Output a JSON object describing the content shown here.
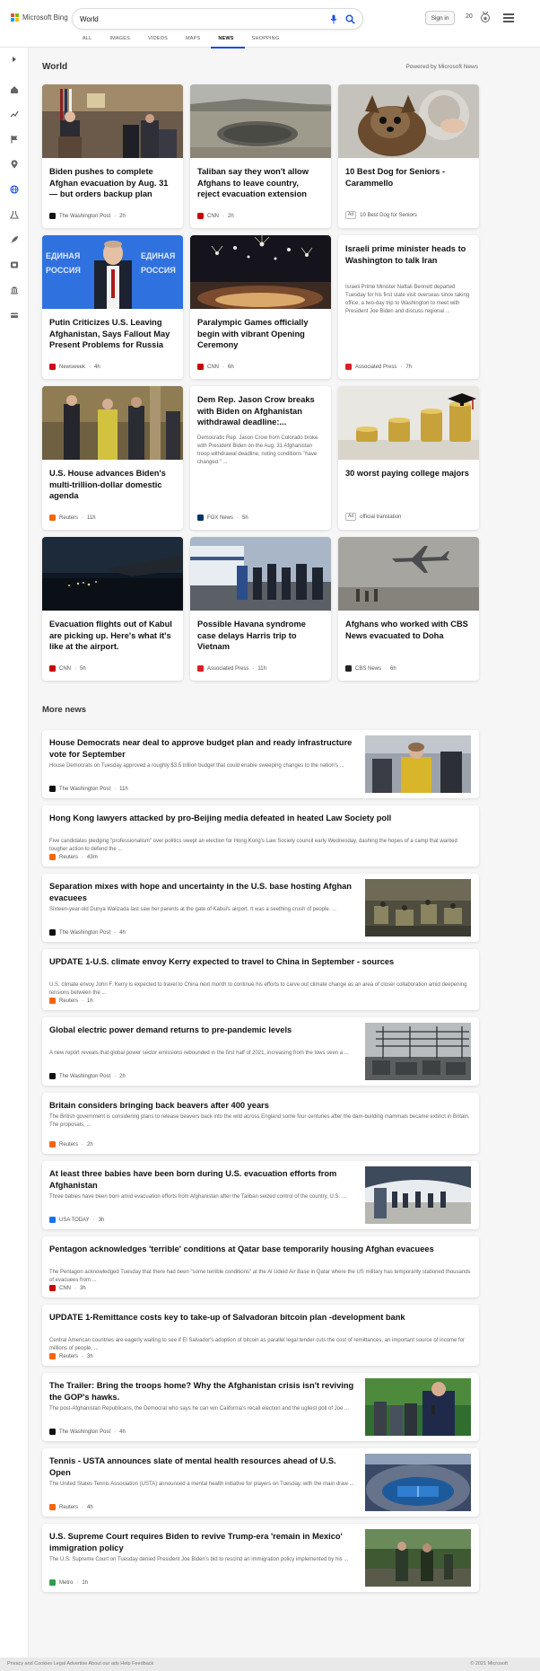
{
  "header": {
    "brand": "Microsoft Bing",
    "search_value": "World",
    "signin": "Sign in",
    "points": "20",
    "tabs": [
      "ALL",
      "IMAGES",
      "VIDEOS",
      "MAPS",
      "NEWS",
      "SHOPPING"
    ],
    "active_tab": "NEWS"
  },
  "section": {
    "title": "World",
    "powered_by": "Powered by Microsoft News"
  },
  "cards": [
    {
      "title": "Biden pushes to complete Afghan evacuation by Aug. 31 — but orders backup plan",
      "source": "The Washington Post",
      "age": "2h",
      "ad": false,
      "favicon_color": "#111111",
      "image": "press-briefing"
    },
    {
      "title": "Taliban say they won't allow Afghans to leave country, reject evacuation extension",
      "source": "CNN",
      "age": "2h",
      "ad": false,
      "favicon_color": "#cc0000",
      "image": "airport-crowd"
    },
    {
      "title": "10 Best Dog for Seniors - Carammello",
      "source": "10 Best Dog for Seniors",
      "age": "",
      "ad": true,
      "ad_label": "Ad",
      "favicon_color": "",
      "image": "dog-senior"
    },
    {
      "title": "Putin Criticizes U.S. Leaving Afghanistan, Says Fallout May Present Problems for Russia",
      "source": "Newsweek",
      "age": "4h",
      "ad": false,
      "favicon_color": "#d0021b",
      "image": "putin-stage",
      "image_text": [
        "ЕДИНАЯ",
        "РОССИЯ",
        "ЕДИНАЯ",
        "РОССИЯ"
      ]
    },
    {
      "title": "Paralympic Games officially begin with vibrant Opening Ceremony",
      "source": "CNN",
      "age": "6h",
      "ad": false,
      "favicon_color": "#cc0000",
      "image": "fireworks-stadium"
    },
    {
      "title": "Israeli prime minister heads to Washington to talk Iran",
      "snippet": "Israeli Prime Minister Naftali Bennett departed Tuesday for his first state visit overseas since taking office, a two-day trip to Washington to meet with President Joe Biden and discuss regional ...",
      "source": "Associated Press",
      "age": "7h",
      "ad": false,
      "favicon_color": "#e31b23",
      "image": ""
    },
    {
      "title": "U.S. House advances Biden's multi-trillion-dollar domestic agenda",
      "source": "Reuters",
      "age": "11h",
      "ad": false,
      "favicon_color": "#fa6400",
      "image": "capitol-walk"
    },
    {
      "title": "Dem Rep. Jason Crow breaks with Biden on Afghanistan withdrawal deadline:...",
      "snippet": "Democratic Rep. Jason Crow from Colorado broke with President Biden on the Aug. 31 Afghanistan troop withdrawal deadline, noting conditions \"have changed.\" ...",
      "source": "FOX News",
      "age": "5h",
      "ad": false,
      "favicon_color": "#003366",
      "image": ""
    },
    {
      "title": "30 worst paying college majors",
      "source": "official translation",
      "age": "",
      "ad": true,
      "ad_label": "Ad",
      "favicon_color": "",
      "image": "coins-cap"
    },
    {
      "title": "Evacuation flights out of Kabul are picking up. Here's what it's like at the airport.",
      "source": "CNN",
      "age": "5h",
      "ad": false,
      "favicon_color": "#cc0000",
      "image": "night-airport"
    },
    {
      "title": "Possible Havana syndrome case delays Harris trip to Vietnam",
      "source": "Associated Press",
      "age": "11h",
      "ad": false,
      "favicon_color": "#e31b23",
      "image": "tarmac-group"
    },
    {
      "title": "Afghans who worked with CBS News evacuated to Doha",
      "source": "CBS News",
      "age": "6h",
      "ad": false,
      "favicon_color": "#222222",
      "image": "plane-haze"
    }
  ],
  "more_news": {
    "title": "More news",
    "items": [
      {
        "title": "House Democrats near deal to approve budget plan and ready infrastructure vote for September",
        "snippet": "House Democrats on Tuesday approved a roughly $3.5 trillion budget that could enable sweeping changes to the nation's ...",
        "source": "The Washington Post",
        "age": "11h",
        "favicon_color": "#111111",
        "image": "pelosi-yellow"
      },
      {
        "title": "Hong Kong lawyers attacked by pro-Beijing media defeated in heated Law Society poll",
        "snippet": "Five candidates pledging \"professionalism\" over politics swept an election for Hong Kong's Law Society council early Wednesday, dashing the hopes of a camp that wanted tougher action to defend the ...",
        "source": "Reuters",
        "age": "43m",
        "favicon_color": "#fa6400",
        "image": ""
      },
      {
        "title": "Separation mixes with hope and uncertainty in the U.S. base hosting Afghan evacuees",
        "snippet": "Sixteen-year-old Dunya Walizada last saw her parents at the gate of Kabul's airport. It was a seething crush of people. ...",
        "source": "The Washington Post",
        "age": "4h",
        "favicon_color": "#111111",
        "image": "evacuees-hangar"
      },
      {
        "title": "UPDATE 1-U.S. climate envoy Kerry expected to travel to China in September - sources",
        "snippet": "U.S. climate envoy John F. Kerry is expected to travel to China next month to continue his efforts to carve out climate change as an area of closer collaboration amid deepening tensions between the ...",
        "source": "Reuters",
        "age": "1h",
        "favicon_color": "#fa6400",
        "image": ""
      },
      {
        "title": "Global electric power demand returns to pre-pandemic levels",
        "snippet": "A new report reveals that global power sector emissions rebounded in the first half of 2021, increasing from the lows seen a ...",
        "source": "The Washington Post",
        "age": "2h",
        "favicon_color": "#111111",
        "image": "power-lines"
      },
      {
        "title": "Britain considers bringing back beavers after 400 years",
        "snippet": "The British government is considering plans to release beavers back into the wild across England some four centuries after the dam-building mammals became extinct in Britain. The proposals, ...",
        "source": "Reuters",
        "age": "2h",
        "favicon_color": "#fa6400",
        "image": ""
      },
      {
        "title": "At least three babies have been born during U.S. evacuation efforts from Afghanistan",
        "snippet": "Three babies have been born amid evacuation efforts from Afghanistan after the Taliban seized control of the country, U.S. ...",
        "source": "USA TODAY",
        "age": "3h",
        "favicon_color": "#1a73e8",
        "image": "plane-boarding"
      },
      {
        "title": "Pentagon acknowledges 'terrible' conditions at Qatar base temporarily housing Afghan evacuees",
        "snippet": "The Pentagon acknowledged Tuesday that there had been \"some terrible conditions\" at the Al Udeid Air Base in Qatar where the US military has temporarily stationed thousands of evacuees from ...",
        "source": "CNN",
        "age": "3h",
        "favicon_color": "#cc0000",
        "image": ""
      },
      {
        "title": "UPDATE 1-Remittance costs key to take-up of Salvadoran bitcoin plan -development bank",
        "snippet": "Central American countries are eagerly waiting to see if El Salvador's adoption of bitcoin as parallel legal tender cuts the cost of remittances, an important source of income for millions of people, ...",
        "source": "Reuters",
        "age": "3h",
        "favicon_color": "#fa6400",
        "image": ""
      },
      {
        "title": "The Trailer: Bring the troops home? Why the Afghanistan crisis isn't reviving the GOP's hawks.",
        "snippet": "The post-Afghanistan Republicans, the Democrat who says he can win California's recall election and the ugliest poll of Joe ...",
        "source": "The Washington Post",
        "age": "4h",
        "favicon_color": "#111111",
        "image": "speaker-crowd"
      },
      {
        "title": "Tennis - USTA announces slate of mental health resources ahead of U.S. Open",
        "snippet": "The United States Tennis Association (USTA) announced a mental health initiative for players on Tuesday, with the main draw ...",
        "source": "Reuters",
        "age": "4h",
        "favicon_color": "#fa6400",
        "image": "tennis-stadium"
      },
      {
        "title": "U.S. Supreme Court requires Biden to revive Trump-era 'remain in Mexico' immigration policy",
        "snippet": "The U.S. Supreme Court on Tuesday denied President Joe Biden's bid to rescind an immigration policy implemented by his ...",
        "source": "Metro",
        "age": "1h",
        "favicon_color": "#2e9e4a",
        "image": "border-patrol"
      }
    ]
  },
  "footer": {
    "left": "Privacy and Cookies   Legal   Advertise   About our ads   Help   Feedback",
    "right": "© 2021 Microsoft"
  }
}
